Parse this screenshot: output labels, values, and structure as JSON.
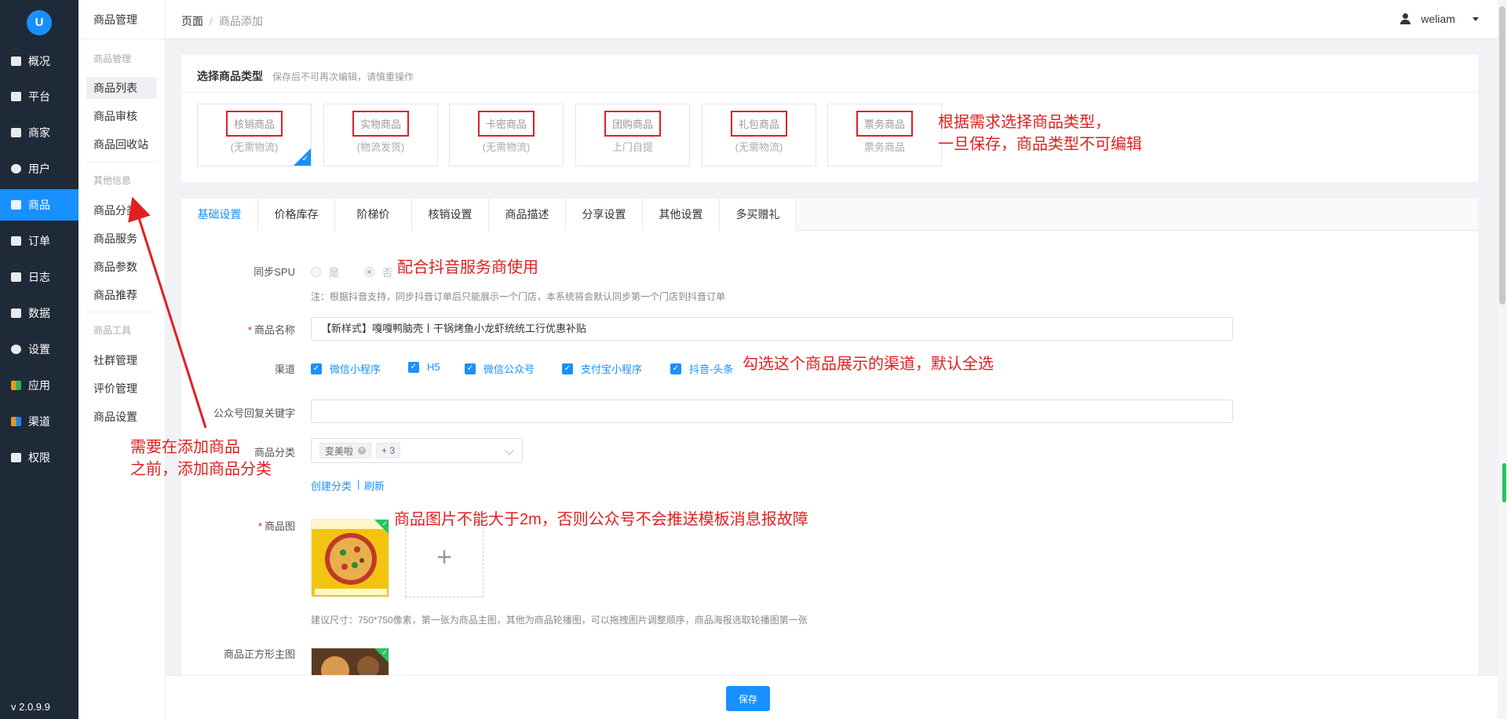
{
  "sidebar": {
    "logo_text": "U",
    "items": [
      {
        "label": "概况",
        "icon": "monitor-icon"
      },
      {
        "label": "平台",
        "icon": "desktop-icon"
      },
      {
        "label": "商家",
        "icon": "store-icon"
      },
      {
        "label": "用户",
        "icon": "user-icon"
      },
      {
        "label": "商品",
        "icon": "goods-icon"
      },
      {
        "label": "订单",
        "icon": "order-icon"
      },
      {
        "label": "日志",
        "icon": "log-icon"
      },
      {
        "label": "数据",
        "icon": "chart-icon"
      },
      {
        "label": "设置",
        "icon": "gear-icon"
      },
      {
        "label": "应用",
        "icon": "apps-icon"
      },
      {
        "label": "渠道",
        "icon": "cube-icon"
      },
      {
        "label": "权限",
        "icon": "lock-icon"
      }
    ],
    "active_index": 4,
    "version": "v 2.0.9.9"
  },
  "submenu": {
    "title": "商品管理",
    "group1": "商品管理",
    "items1": [
      "商品列表",
      "商品审核",
      "商品回收站"
    ],
    "group2": "其他信息",
    "items2": [
      "商品分类",
      "商品服务",
      "商品参数",
      "商品推荐"
    ],
    "group3": "商品工具",
    "items3": [
      "社群管理",
      "评价管理",
      "商品设置"
    ]
  },
  "header": {
    "breadcrumb_home": "页面",
    "breadcrumb_sep": "/",
    "breadcrumb_current": "商品添加",
    "username": "weliam"
  },
  "type_section": {
    "title": "选择商品类型",
    "subtitle": "保存后不可再次编辑，请慎重操作",
    "types": [
      {
        "name": "核销商品",
        "desc": "(无需物流)",
        "selected": true
      },
      {
        "name": "实物商品",
        "desc": "(物流发货)",
        "selected": false
      },
      {
        "name": "卡密商品",
        "desc": "(无需物流)",
        "selected": false
      },
      {
        "name": "团购商品",
        "desc": "上门自提",
        "selected": false
      },
      {
        "name": "礼包商品",
        "desc": "(无需物流)",
        "selected": false
      },
      {
        "name": "票务商品",
        "desc": "票务商品",
        "selected": false
      }
    ]
  },
  "tabs": [
    "基础设置",
    "价格库存",
    "阶梯价",
    "核销设置",
    "商品描述",
    "分享设置",
    "其他设置",
    "多买赠礼"
  ],
  "form": {
    "spu_label": "同步SPU",
    "spu_yes": "是",
    "spu_no": "否",
    "spu_note": "注：根据抖音支持，同步抖音订单后只能展示一个门店，本系统将会默认同步第一个门店到抖音订单",
    "name_label": "商品名称",
    "name_value": "【新样式】嘎嘎鸭脑壳丨干锅烤鱼小龙虾统统工行优惠补贴",
    "channel_label": "渠道",
    "channels": [
      "微信小程序",
      "H5",
      "微信公众号",
      "支付宝小程序",
      "抖音-头条"
    ],
    "keyword_label": "公众号回复关键字",
    "keyword_value": "",
    "category_label": "商品分类",
    "category_tag": "变美啦",
    "category_more": "+ 3",
    "create_category": "创建分类",
    "link_sep": "|",
    "refresh": "刷新",
    "image_label": "商品图",
    "image_plus": "+",
    "image_note": "建议尺寸：750*750像素，第一张为商品主图，其他为商品轮播图，可以拖拽图片调整顺序，商品海报选取轮播图第一张",
    "square_label": "商品正方形主图"
  },
  "annotations": {
    "type_line1": "根据需求选择商品类型，",
    "type_line2": "一旦保存，商品类型不可编辑",
    "spu": "配合抖音服务商使用",
    "channel": "勾选这个商品展示的渠道，默认全选",
    "category_line1": "需要在添加商品",
    "category_line2": "之前，添加商品分类",
    "image": "商品图片不能大于2m，否则公众号不会推送模板消息报故障"
  },
  "footer": {
    "save_label": "保存"
  },
  "colors": {
    "accent": "#1890ff",
    "sidebar_bg": "#1f2a38",
    "annotation": "#e02020",
    "check_green": "#27c360"
  }
}
